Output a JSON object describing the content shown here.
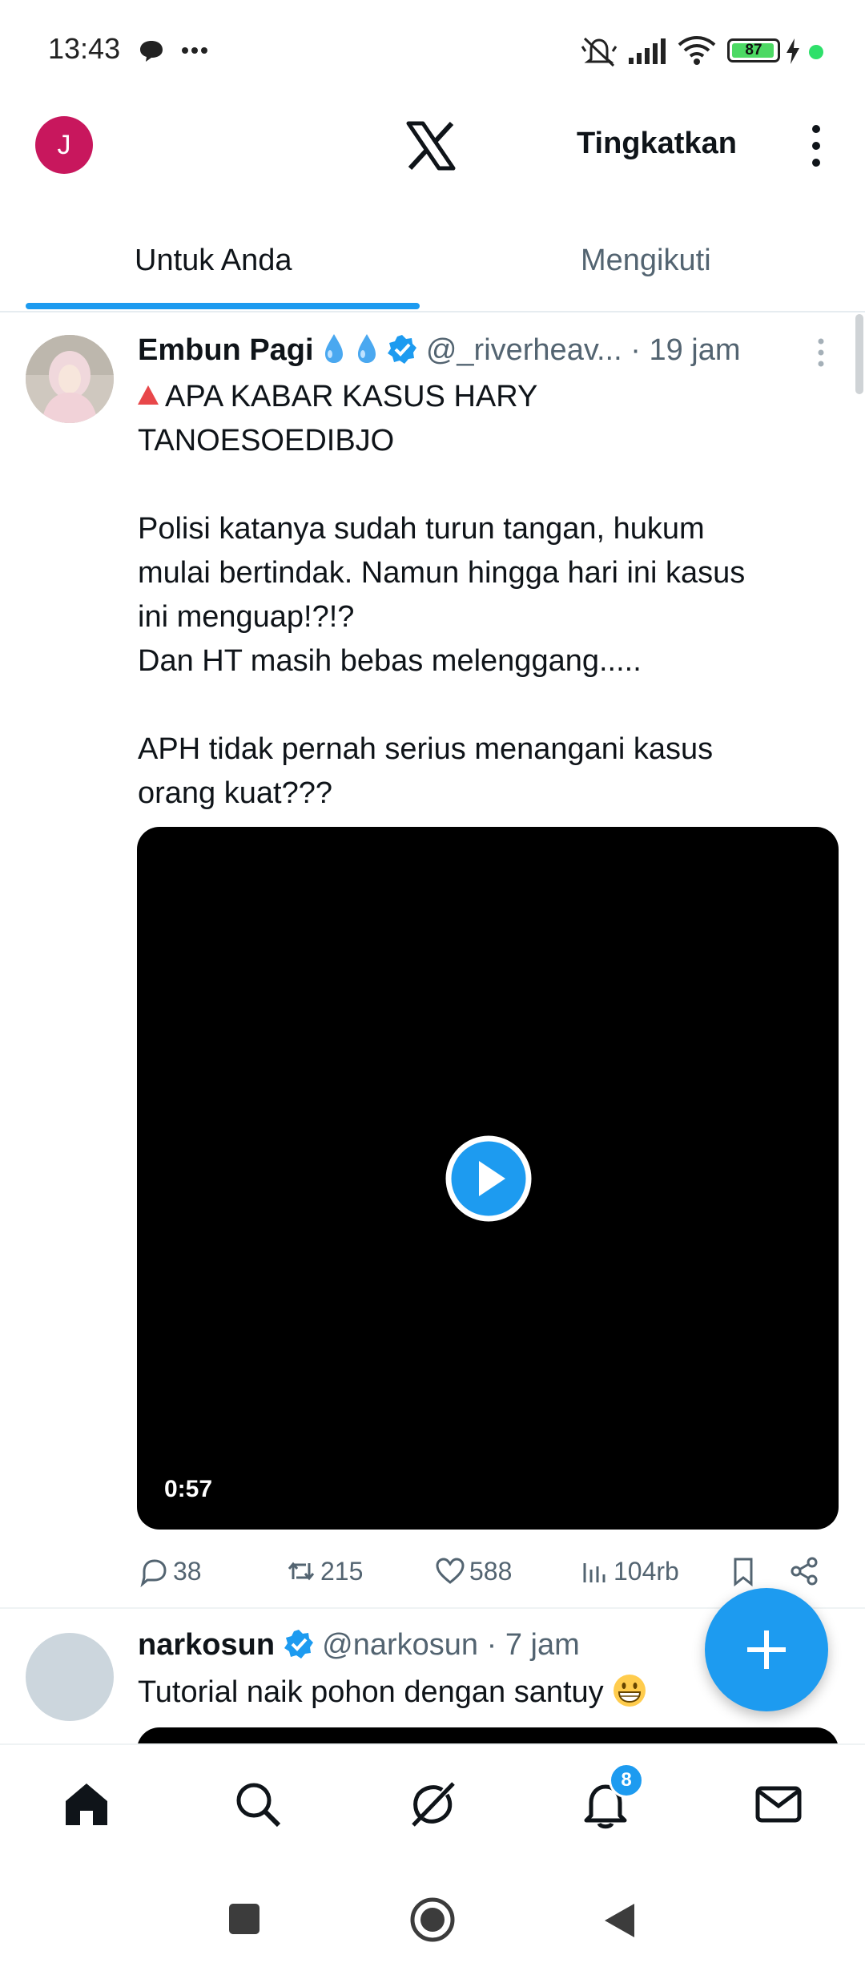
{
  "status_bar": {
    "time": "13:43",
    "battery": "87",
    "icons": [
      "chat-bubble-icon",
      "more-dots-icon",
      "mute-icon",
      "signal-icon",
      "wifi-icon",
      "battery-icon",
      "charging-icon"
    ]
  },
  "header": {
    "avatar_initial": "J",
    "upgrade_label": "Tingkatkan"
  },
  "tabs": [
    {
      "label": "Untuk Anda",
      "active": true
    },
    {
      "label": "Mengikuti",
      "active": false
    }
  ],
  "tweets": [
    {
      "name": "Embun Pagi",
      "handle": "@_riverheav...",
      "time": "· 19 jam",
      "lines": [
        "APA KABAR KASUS HARY",
        "TANOESOEDIBJO",
        "",
        "Polisi katanya sudah turun tangan, hukum",
        "mulai bertindak. Namun hingga hari ini kasus",
        "ini menguap!?!?",
        "Dan HT masih bebas melenggang.....",
        "",
        "APH tidak pernah serius menangani kasus",
        "orang kuat???"
      ],
      "video_duration": "0:57",
      "stats": {
        "replies": "38",
        "reposts": "215",
        "likes": "588",
        "views": "104rb"
      }
    },
    {
      "name": "narkosun",
      "handle": "@narkosun",
      "time": "· 7 jam",
      "text": "Tutorial naik pohon dengan santuy"
    }
  ],
  "bottom_nav": {
    "items": [
      "home-icon",
      "search-icon",
      "grok-icon",
      "notifications-icon",
      "messages-icon"
    ],
    "notification_count": "8"
  },
  "colors": {
    "accent": "#1d9bf0",
    "avatar_bg": "#c8175d",
    "text": "#0f1419",
    "muted": "#536471"
  }
}
